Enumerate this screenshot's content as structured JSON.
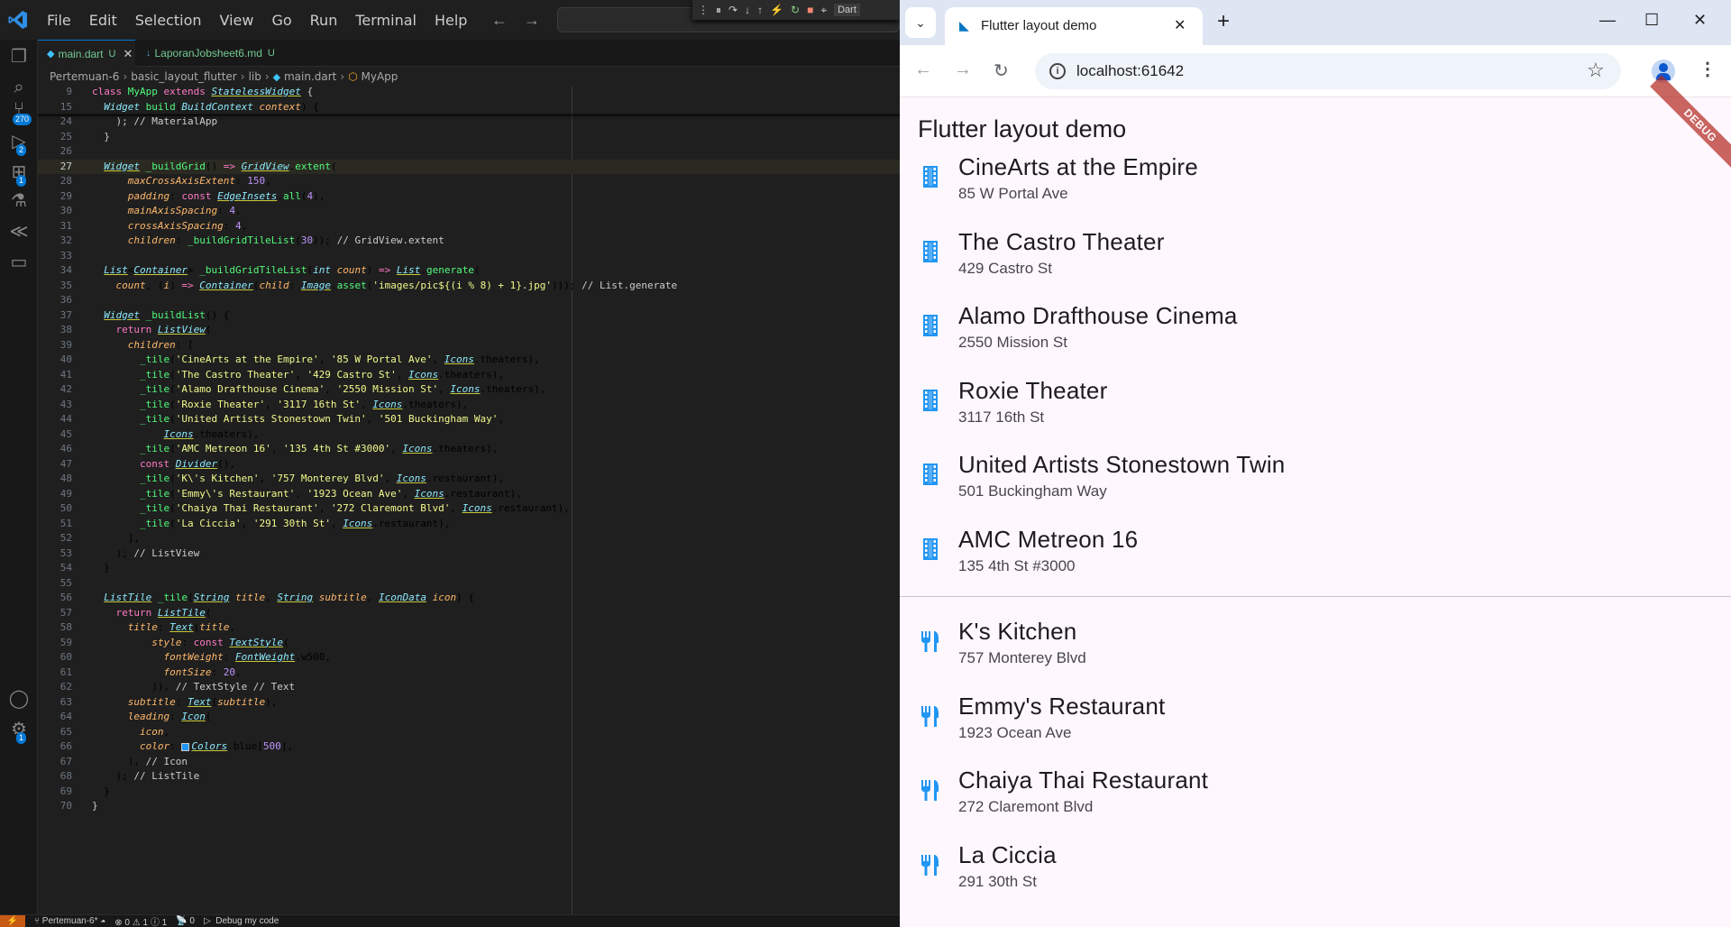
{
  "vscode": {
    "menu": [
      "File",
      "Edit",
      "Selection",
      "View",
      "Go",
      "Run",
      "Terminal",
      "Help"
    ],
    "debug_label": "Dart",
    "activity_badges": {
      "source_control": "270",
      "run": "2",
      "extensions": "1",
      "settings": "1"
    },
    "tabs": [
      {
        "name": "main.dart",
        "status": "U",
        "active": true
      },
      {
        "name": "LaporanJobsheet6.md",
        "status": "U",
        "active": false
      }
    ],
    "breadcrumb": [
      "Pertemuan-6",
      "basic_layout_flutter",
      "lib",
      "main.dart",
      "MyApp"
    ],
    "status_bar": {
      "branch": "Pertemuan-6*",
      "problems": "⊗ 0 ⚠ 1 ⓘ 1",
      "ports": "0",
      "debug": "Debug my code"
    }
  },
  "chrome": {
    "tab_title": "Flutter layout demo",
    "url": "localhost:61642"
  },
  "app": {
    "title": "Flutter layout demo",
    "debug_banner": "DEBUG",
    "theaters": [
      {
        "title": "CineArts at the Empire",
        "subtitle": "85 W Portal Ave"
      },
      {
        "title": "The Castro Theater",
        "subtitle": "429 Castro St"
      },
      {
        "title": "Alamo Drafthouse Cinema",
        "subtitle": "2550 Mission St"
      },
      {
        "title": "Roxie Theater",
        "subtitle": "3117 16th St"
      },
      {
        "title": "United Artists Stonestown Twin",
        "subtitle": "501 Buckingham Way"
      },
      {
        "title": "AMC Metreon 16",
        "subtitle": "135 4th St #3000"
      }
    ],
    "restaurants": [
      {
        "title": "K's Kitchen",
        "subtitle": "757 Monterey Blvd"
      },
      {
        "title": "Emmy's Restaurant",
        "subtitle": "1923 Ocean Ave"
      },
      {
        "title": "Chaiya Thai Restaurant",
        "subtitle": "272 Claremont Blvd"
      },
      {
        "title": "La Ciccia",
        "subtitle": "291 30th St"
      }
    ],
    "icon_color": "#2196f3"
  }
}
